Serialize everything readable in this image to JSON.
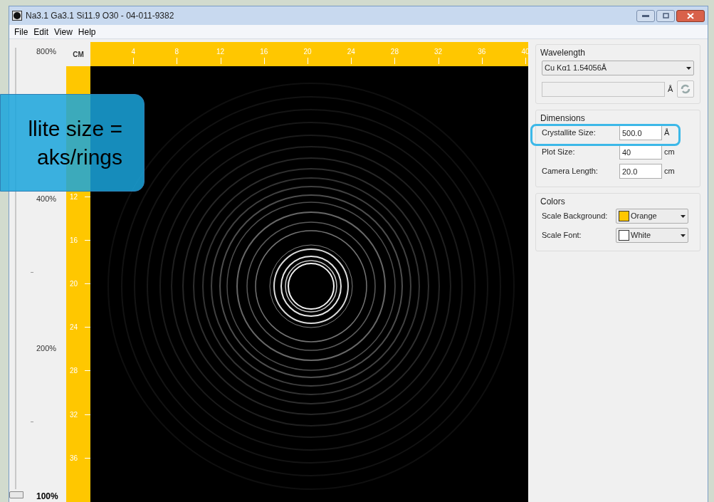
{
  "window": {
    "title": "Na3.1 Ga3.1 Si11.9 O30 - 04-011-9382"
  },
  "menu": [
    "File",
    "Edit",
    "View",
    "Help"
  ],
  "zoom_slider": {
    "labels": [
      "800%",
      "400%",
      "200%",
      "100%"
    ],
    "level": 0
  },
  "ruler": {
    "unit": "CM",
    "top_ticks": [
      "4",
      "8",
      "12",
      "16",
      "20",
      "24",
      "28",
      "32",
      "36",
      "40"
    ],
    "left_ticks": [
      "12",
      "16",
      "20",
      "24",
      "28",
      "32",
      "36"
    ]
  },
  "wavelength": {
    "title": "Wavelength",
    "selected": "Cu Kα1 1.54056Å",
    "custom_unit": "Å"
  },
  "dimensions": {
    "title": "Dimensions",
    "rows": [
      {
        "label": "Crystallite Size:",
        "value": "500.0",
        "unit": "Å"
      },
      {
        "label": "Plot Size:",
        "value": "40",
        "unit": "cm"
      },
      {
        "label": "Camera Length:",
        "value": "20.0",
        "unit": "cm"
      }
    ]
  },
  "colors": {
    "title": "Colors",
    "rows": [
      {
        "label": "Scale Background:",
        "value": "Orange",
        "color": "#ffc700"
      },
      {
        "label": "Scale Font:",
        "value": "White",
        "color": "#ffffff"
      }
    ]
  },
  "callout": {
    "lines": [
      "llite size =",
      "aks/rings"
    ]
  }
}
